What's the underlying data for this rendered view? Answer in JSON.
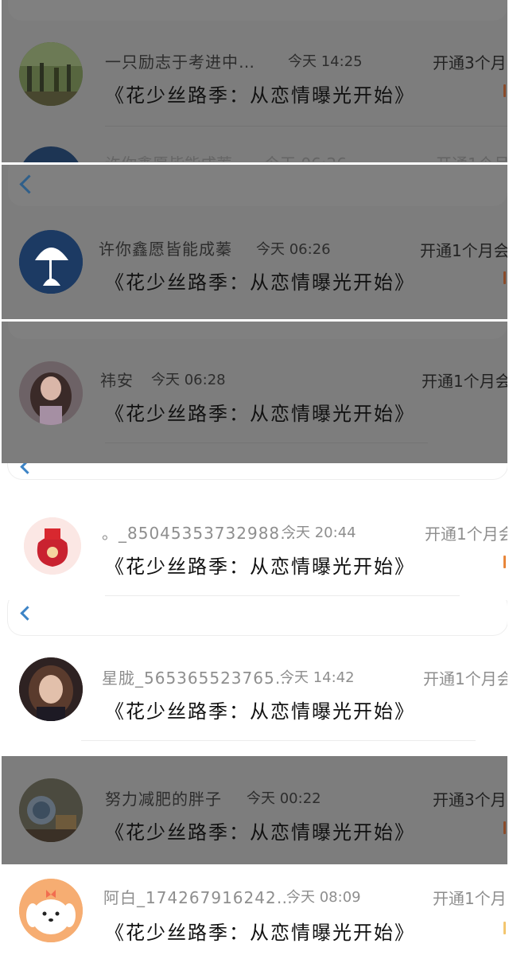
{
  "message": "《花少丝路季：从恋情曝光开始》",
  "rows": [
    {
      "name": "一只励志于考进中…",
      "time": "今天 14:25",
      "subscription": "开通3个月"
    },
    {
      "name": "许你鑫愿皆能成蓁",
      "time": "今天 06:26",
      "subscription": "开通1个月会"
    },
    {
      "name": "祎安",
      "time": "今天 06:28",
      "subscription": "开通1个月会"
    },
    {
      "name": "。_85045353732988…",
      "time": "今天 20:44",
      "subscription": "开通1个月会"
    },
    {
      "name": "星胧_565365523765…",
      "time": "今天 14:42",
      "subscription": "开通1个月会"
    },
    {
      "name": "努力减肥的胖子",
      "time": "今天 00:22",
      "subscription": "开通3个月"
    },
    {
      "name": "阿白_174267916242…",
      "time": "今天 08:09",
      "subscription": "开通1个月"
    }
  ],
  "ghost_row": {
    "name": "许你鑫愿皆能成蓁",
    "time": "今天 06:26",
    "subscription": "开通1个月"
  },
  "colors": {
    "dim_overlay": "#7d7d7d",
    "accent_blue": "#3d84c6",
    "accent_orange": "#e8863a"
  },
  "icons": {
    "back": "chevron-left-icon"
  }
}
